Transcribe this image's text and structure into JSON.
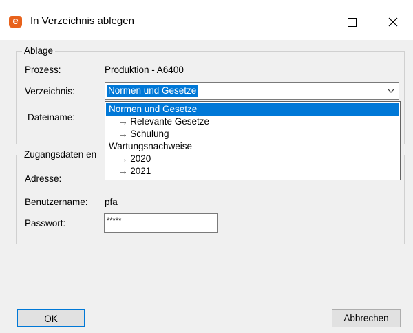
{
  "window": {
    "title": "In Verzeichnis ablegen",
    "icon_letter": "e",
    "controls": {
      "minimize": "—",
      "maximize": "☐",
      "close": "✕"
    }
  },
  "ablage": {
    "group_label": "Ablage",
    "prozess_label": "Prozess:",
    "prozess_value": "Produktion - A6400",
    "verzeichnis_label": "Verzeichnis:",
    "verzeichnis_selected": "Normen und Gesetze",
    "dateiname_label": "Dateiname:",
    "dropdown_options": [
      "Normen und Gesetze",
      "→ Relevante Gesetze",
      "→ Schulung",
      "Wartungsnachweise",
      "→ 2020",
      "→ 2021"
    ]
  },
  "zugang": {
    "group_label": "Zugangsdaten en",
    "adresse_label": "Adresse:",
    "benutzername_label": "Benutzername:",
    "benutzername_value": "pfa",
    "passwort_label": "Passwort:",
    "passwort_value": "*****"
  },
  "buttons": {
    "ok": "OK",
    "cancel": "Abbrechen"
  },
  "colors": {
    "accent": "#0078d7",
    "brand": "#e8621b"
  }
}
